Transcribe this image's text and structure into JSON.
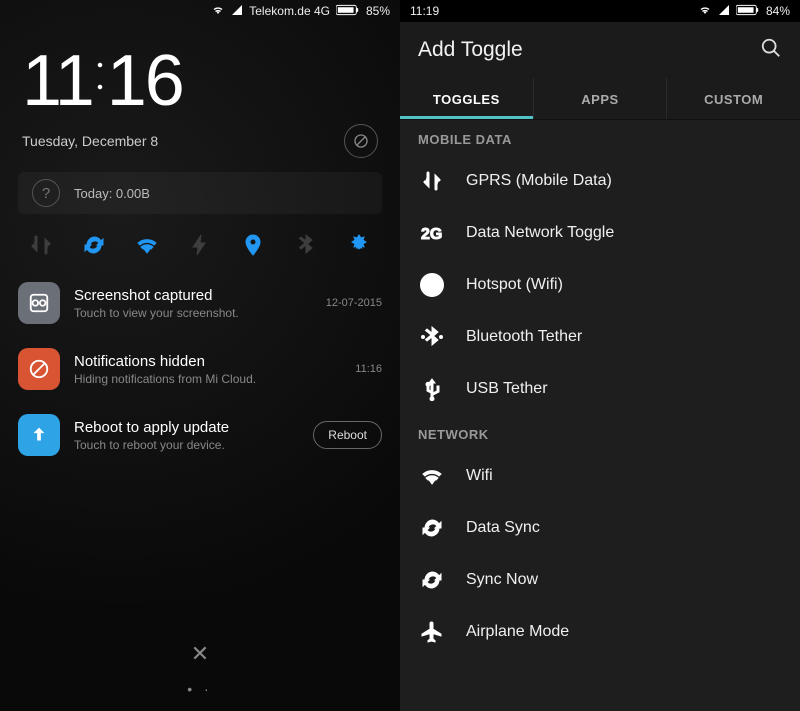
{
  "left": {
    "status": {
      "carrier": "Telekom.de 4G",
      "battery": "85%"
    },
    "clock": {
      "h": "11",
      "m": "16"
    },
    "date": "Tuesday, December 8",
    "usage": "Today: 0.00B",
    "toggles": [
      {
        "name": "mobile-data",
        "on": false
      },
      {
        "name": "sync",
        "on": true
      },
      {
        "name": "wifi",
        "on": true
      },
      {
        "name": "flash",
        "on": false
      },
      {
        "name": "location",
        "on": true
      },
      {
        "name": "bluetooth",
        "on": false
      },
      {
        "name": "auto-brightness",
        "on": true
      }
    ],
    "notifications": [
      {
        "icon": "screenshot",
        "color": "#6b6f78",
        "title": "Screenshot captured",
        "sub": "Touch to view your screenshot.",
        "meta": "12-07-2015"
      },
      {
        "icon": "block",
        "color": "#d95433",
        "title": "Notifications hidden",
        "sub": "Hiding notifications from Mi Cloud.",
        "meta": "11:16"
      },
      {
        "icon": "update",
        "color": "#2ea3e6",
        "title": "Reboot to apply update",
        "sub": "Touch to reboot your device.",
        "action": "Reboot"
      }
    ],
    "page_dots": "• ·"
  },
  "right": {
    "status": {
      "time": "11:19",
      "battery": "84%"
    },
    "title": "Add Toggle",
    "tabs": [
      "TOGGLES",
      "APPS",
      "CUSTOM"
    ],
    "active_tab": 0,
    "sections": [
      {
        "header": "MOBILE DATA",
        "items": [
          {
            "icon": "data-arrows",
            "label": "GPRS (Mobile Data)"
          },
          {
            "icon": "2g",
            "label": "Data Network Toggle"
          },
          {
            "icon": "hotspot",
            "label": "Hotspot (Wifi)"
          },
          {
            "icon": "bt-tether",
            "label": "Bluetooth Tether"
          },
          {
            "icon": "usb",
            "label": "USB Tether"
          }
        ]
      },
      {
        "header": "NETWORK",
        "items": [
          {
            "icon": "wifi",
            "label": "Wifi"
          },
          {
            "icon": "sync",
            "label": "Data Sync"
          },
          {
            "icon": "sync",
            "label": "Sync Now"
          },
          {
            "icon": "airplane",
            "label": "Airplane Mode"
          }
        ]
      }
    ]
  }
}
